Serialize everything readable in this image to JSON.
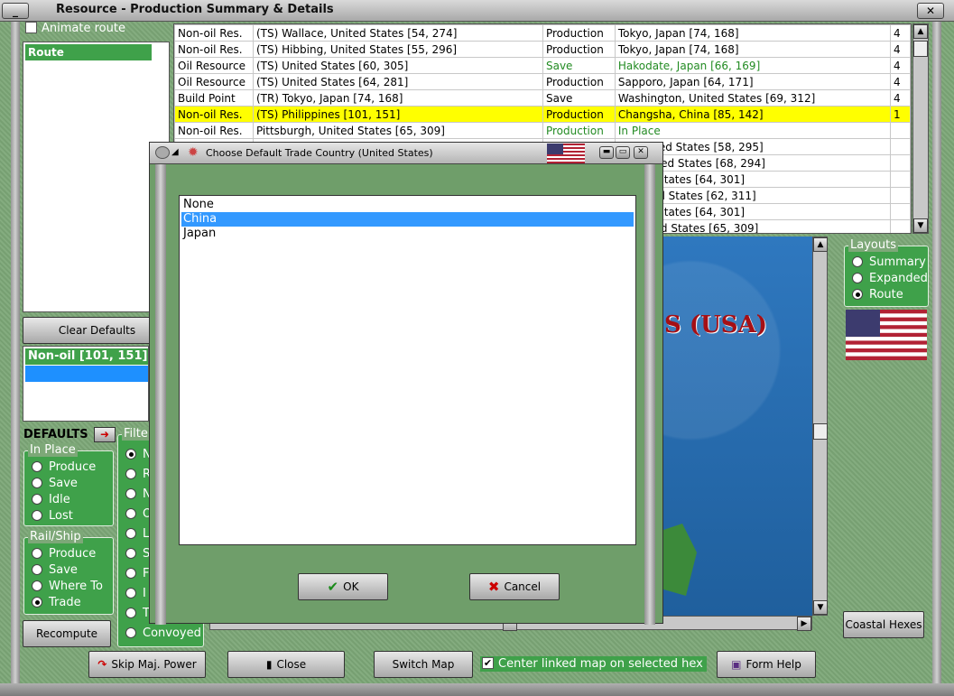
{
  "window": {
    "title": "Resource - Production Summary & Details",
    "minimize_label": "_",
    "close_label": "✕"
  },
  "left": {
    "animate_route_label": "Animate route",
    "route_header": "Route",
    "clear_defaults_label": "Clear Defaults",
    "nonoil_header": "Non-oil [101, 151]",
    "defaults_label": "DEFAULTS",
    "defaults_arrow_label": "➜",
    "in_place": {
      "legend": "In Place",
      "options": [
        "Produce",
        "Save",
        "Idle",
        "Lost"
      ]
    },
    "rail_ship": {
      "legend": "Rail/Ship",
      "options": [
        "Produce",
        "Save",
        "Where To",
        "Trade"
      ],
      "selected": "Trade"
    },
    "filter": {
      "legend": "Filte",
      "options": [
        "N",
        "R",
        "N",
        "O",
        "L",
        "S",
        "F",
        "I",
        "T",
        "Convoyed"
      ],
      "selected": "N"
    },
    "recompute_label": "Recompute"
  },
  "table": {
    "rows": [
      {
        "type": "Non-oil Res.",
        "from": "(TS) Wallace, United States [54, 274]",
        "action": "Production",
        "to": "Tokyo, Japan [74, 168]",
        "n": "4",
        "green": false,
        "highlight": false
      },
      {
        "type": "Non-oil Res.",
        "from": "(TS) Hibbing, United States [55, 296]",
        "action": "Production",
        "to": "Tokyo, Japan [74, 168]",
        "n": "4",
        "green": false,
        "highlight": false
      },
      {
        "type": "Oil Resource",
        "from": "(TS) United States [60, 305]",
        "action": "Save",
        "to": "Hakodate, Japan [66, 169]",
        "n": "4",
        "green": true,
        "highlight": false
      },
      {
        "type": "Oil Resource",
        "from": "(TS) United States [64, 281]",
        "action": "Production",
        "to": "Sapporo, Japan [64, 171]",
        "n": "4",
        "green": false,
        "highlight": false
      },
      {
        "type": "Build Point",
        "from": "(TR) Tokyo, Japan [74, 168]",
        "action": "Save",
        "to": "Washington, United States [69, 312]",
        "n": "4",
        "green": false,
        "highlight": false
      },
      {
        "type": "Non-oil Res.",
        "from": "(TS) Philippines [101, 151]",
        "action": "Production",
        "to": "Changsha, China [85, 142]",
        "n": "1",
        "green": false,
        "highlight": true
      },
      {
        "type": "Non-oil Res.",
        "from": "Pittsburgh, United States [65, 309]",
        "action": "Production",
        "to": "In Place",
        "n": "",
        "green": true,
        "highlight": false
      },
      {
        "type": "",
        "from": "",
        "action": "",
        "to": "lis, United States [58, 295]",
        "n": "",
        "green": false,
        "highlight": false
      },
      {
        "type": "",
        "from": "",
        "action": "",
        "to": "ity, United States [68, 294]",
        "n": "",
        "green": false,
        "highlight": false
      },
      {
        "type": "",
        "from": "",
        "action": "",
        "to": "United States [64, 301]",
        "n": "",
        "green": false,
        "highlight": false
      },
      {
        "type": "",
        "from": "",
        "action": "",
        "to": "r, United States [62, 311]",
        "n": "",
        "green": false,
        "highlight": false
      },
      {
        "type": "",
        "from": "",
        "action": "",
        "to": "United States [64, 301]",
        "n": "",
        "green": false,
        "highlight": false
      },
      {
        "type": "",
        "from": "",
        "action": "",
        "to": "n, United States [65, 309]",
        "n": "",
        "green": false,
        "highlight": false
      }
    ]
  },
  "map": {
    "title": "S (USA)"
  },
  "layouts": {
    "legend": "Layouts",
    "options": [
      "Summary",
      "Expanded",
      "Route"
    ],
    "selected": "Route"
  },
  "bottom": {
    "skip_label": "Skip Maj. Power",
    "close_label": "Close",
    "switch_map_label": "Switch Map",
    "center_linked_label": "Center linked map on selected hex",
    "form_help_label": "Form Help",
    "coastal_hexes_label": "Coastal Hexes"
  },
  "dialog": {
    "title": "Choose Default Trade Country (United States)",
    "items": [
      "None",
      "China",
      "Japan"
    ],
    "selected": "China",
    "ok_label": "OK",
    "cancel_label": "Cancel"
  },
  "colors": {
    "panel_green": "#3fa14a",
    "highlight_yellow": "#ffff00",
    "selection_blue": "#3399ff",
    "map_sea": "#2a6fb0",
    "map_title_red": "#a50f15"
  }
}
